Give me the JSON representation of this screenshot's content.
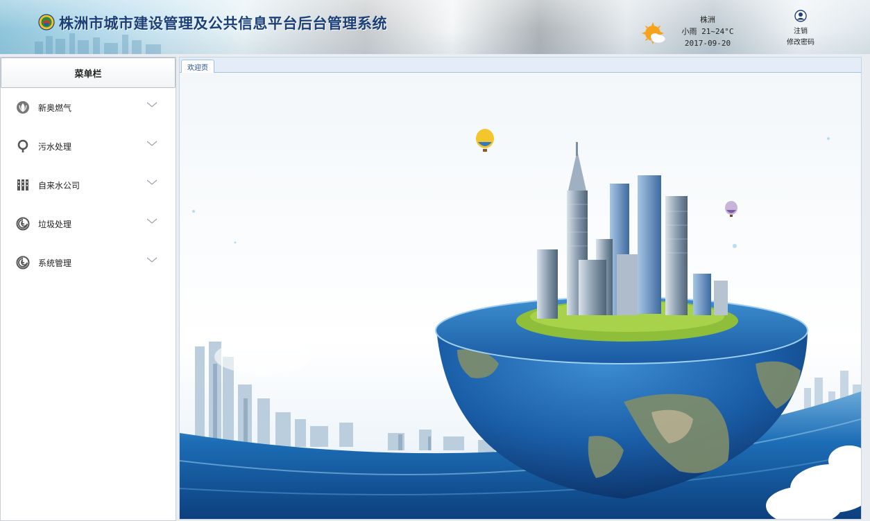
{
  "header": {
    "title": "株洲市城市建设管理及公共信息平台后台管理系统",
    "logo_icon": "city-emblem-icon",
    "weather": {
      "city": "株洲",
      "condition_temp": "小雨 21~24°C",
      "date": "2017-09-20",
      "icon": "sun-cloud-icon"
    },
    "user": {
      "icon": "user-icon",
      "logout_label": "注销",
      "change_password_label": "修改密码"
    }
  },
  "sidebar": {
    "title": "菜单栏",
    "items": [
      {
        "label": "新奥燃气",
        "icon": "gas-flame-icon"
      },
      {
        "label": "污水处理",
        "icon": "map-pin-icon"
      },
      {
        "label": "自来水公司",
        "icon": "water-building-icon"
      },
      {
        "label": "垃圾处理",
        "icon": "swirl-icon"
      },
      {
        "label": "系统管理",
        "icon": "swirl-icon"
      }
    ]
  },
  "content": {
    "tabs": [
      {
        "label": "欢迎页"
      }
    ]
  },
  "colors": {
    "title_blue": "#1b3f78",
    "tab_border": "#9ec2e6",
    "ocean_blue": "#1a6fb8"
  }
}
